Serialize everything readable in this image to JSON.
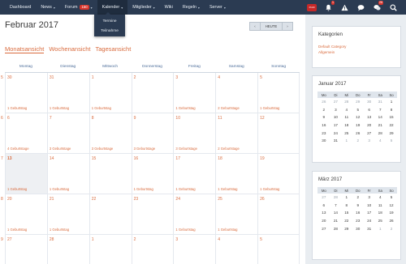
{
  "nav": {
    "items": [
      {
        "label": "Dashboard",
        "caret": false
      },
      {
        "label": "News",
        "caret": true
      },
      {
        "label": "Forum",
        "badge": "150",
        "caret": true
      },
      {
        "label": "Kalender",
        "caret": true
      },
      {
        "label": "Mitglieder",
        "caret": true
      },
      {
        "label": "Wiki",
        "caret": false
      },
      {
        "label": "Regeln",
        "caret": true
      },
      {
        "label": "Server",
        "caret": true
      }
    ],
    "user_badge": "Profil",
    "notifications_count": "1",
    "messages_count": "28"
  },
  "dropdown": {
    "items": [
      "Termine",
      "Teilnahme"
    ]
  },
  "header": {
    "month_title": "Februar 2017",
    "prev": "‹",
    "today": "HEUTE",
    "next": "›"
  },
  "views": [
    "Monatsansicht",
    "Wochenansicht",
    "Tagesansicht"
  ],
  "weekdays": [
    "Montag",
    "Dienstag",
    "Mittwoch",
    "Donnerstag",
    "Freitag",
    "Samstag",
    "Sonntag"
  ],
  "event_label": "1 Geburtstag",
  "weeks": [
    {
      "num": "5",
      "days": [
        {
          "d": "30",
          "e": "1 Geburtstag",
          "other": true
        },
        {
          "d": "31",
          "e": "1 Geburtstag",
          "other": true
        },
        {
          "d": "1",
          "e": "1 Geburtstag"
        },
        {
          "d": "2",
          "e": ""
        },
        {
          "d": "3",
          "e": "1 Geburtstag"
        },
        {
          "d": "4",
          "e": "2 Geburtstage"
        },
        {
          "d": "5",
          "e": "1 Geburtstag"
        }
      ]
    },
    {
      "num": "6",
      "days": [
        {
          "d": "6",
          "e": "4 Geburtstage"
        },
        {
          "d": "7",
          "e": "3 Geburtstage"
        },
        {
          "d": "8",
          "e": "3 Geburtstage"
        },
        {
          "d": "9",
          "e": "3 Geburtstage"
        },
        {
          "d": "10",
          "e": "3 Geburtstage"
        },
        {
          "d": "11",
          "e": "2 Geburtstage"
        },
        {
          "d": "12",
          "e": ""
        }
      ]
    },
    {
      "num": "7",
      "days": [
        {
          "d": "13",
          "e": "1 Geburtstag",
          "today": true
        },
        {
          "d": "14",
          "e": "1 Geburtstag"
        },
        {
          "d": "15",
          "e": ""
        },
        {
          "d": "16",
          "e": "1 Geburtstag"
        },
        {
          "d": "17",
          "e": "1 Geburtstag"
        },
        {
          "d": "18",
          "e": "1 Geburtstag"
        },
        {
          "d": "19",
          "e": "1 Geburtstag"
        }
      ]
    },
    {
      "num": "8",
      "days": [
        {
          "d": "20",
          "e": "1 Geburtstag"
        },
        {
          "d": "21",
          "e": "1 Geburtstag"
        },
        {
          "d": "22",
          "e": ""
        },
        {
          "d": "23",
          "e": ""
        },
        {
          "d": "24",
          "e": "1 Geburtstag"
        },
        {
          "d": "25",
          "e": "1 Geburtstag"
        },
        {
          "d": "26",
          "e": ""
        }
      ]
    },
    {
      "num": "9",
      "days": [
        {
          "d": "27",
          "e": "",
          "partial": true
        },
        {
          "d": "28",
          "e": ""
        },
        {
          "d": "1",
          "e": "",
          "other": true
        },
        {
          "d": "2",
          "e": "",
          "other": true
        },
        {
          "d": "3",
          "e": "",
          "other": true
        },
        {
          "d": "4",
          "e": "",
          "other": true
        },
        {
          "d": "5",
          "e": "",
          "other": true
        }
      ]
    }
  ],
  "sidebar": {
    "categories_title": "Kategorien",
    "categories": [
      "Default Category",
      "Allgemein"
    ],
    "cal1_title": "Januar 2017",
    "cal2_title": "März 2017",
    "mini_weekdays": [
      "Mo",
      "Di",
      "Mi",
      "Do",
      "Fr",
      "Sa",
      "So"
    ],
    "cal1": [
      [
        "26",
        "27",
        "28",
        "29",
        "30",
        "31",
        "1"
      ],
      [
        "2",
        "3",
        "4",
        "5",
        "6",
        "7",
        "8"
      ],
      [
        "9",
        "10",
        "11",
        "12",
        "13",
        "14",
        "15"
      ],
      [
        "16",
        "17",
        "18",
        "19",
        "20",
        "21",
        "22"
      ],
      [
        "23",
        "24",
        "25",
        "26",
        "27",
        "28",
        "29"
      ],
      [
        "30",
        "31",
        "1",
        "2",
        "3",
        "4",
        "5"
      ]
    ],
    "cal1_other": [
      [
        0,
        1,
        2,
        3,
        4,
        5
      ],
      [],
      [],
      [],
      [],
      [
        2,
        3,
        4,
        5,
        6
      ]
    ],
    "cal2": [
      [
        "27",
        "28",
        "1",
        "2",
        "3",
        "4",
        "5"
      ],
      [
        "6",
        "7",
        "8",
        "9",
        "10",
        "11",
        "12"
      ],
      [
        "13",
        "14",
        "15",
        "16",
        "17",
        "18",
        "19"
      ],
      [
        "20",
        "21",
        "22",
        "23",
        "24",
        "25",
        "26"
      ],
      [
        "27",
        "28",
        "29",
        "30",
        "31",
        "1",
        "2"
      ]
    ],
    "cal2_other": [
      [
        0,
        1
      ],
      [],
      [],
      [],
      [
        5,
        6
      ]
    ]
  }
}
